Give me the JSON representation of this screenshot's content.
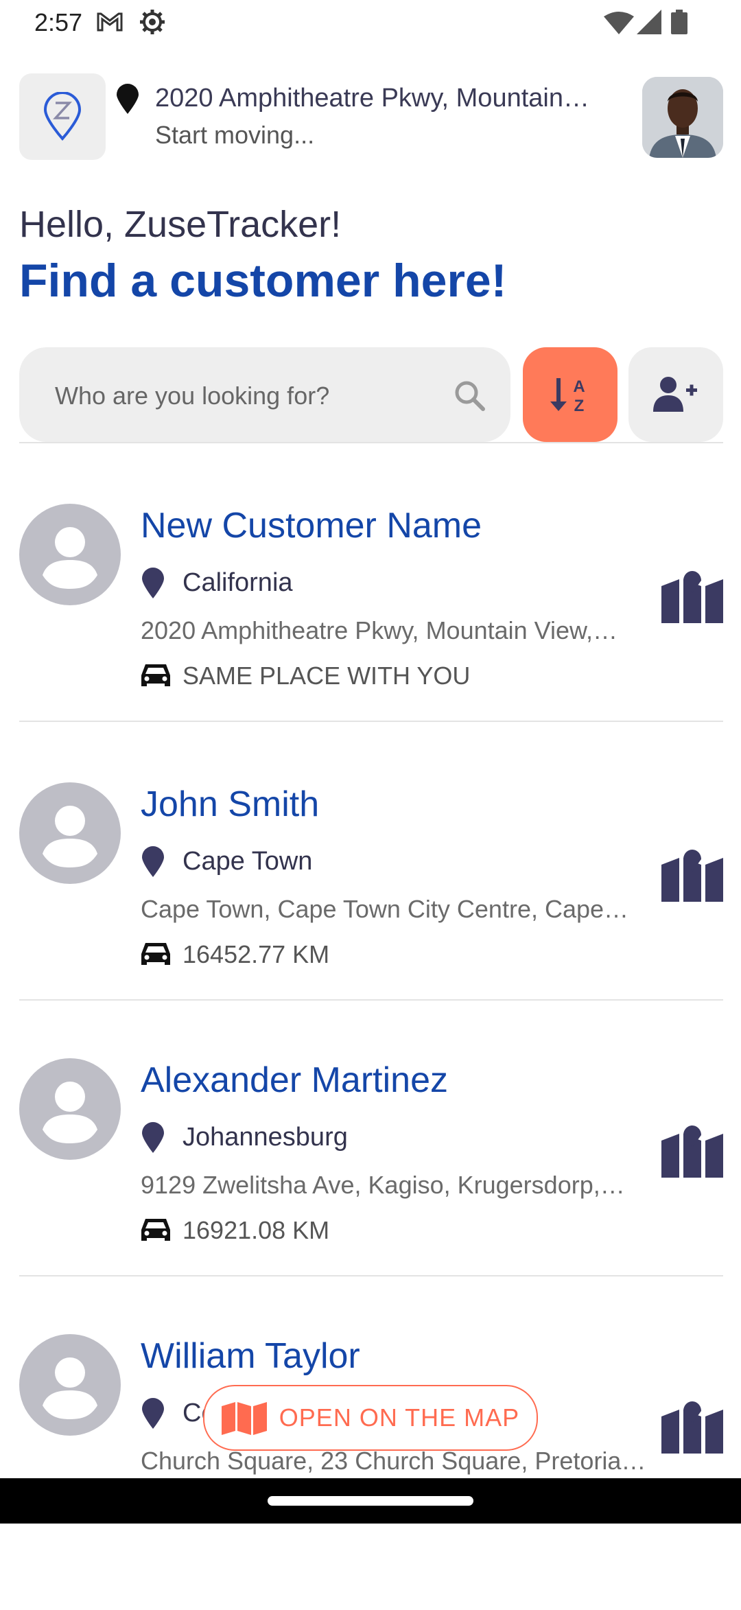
{
  "status_bar": {
    "time": "2:57",
    "icons": [
      "gmail-icon",
      "settings-gear-icon",
      "wifi-icon",
      "cell-signal-icon",
      "battery-icon"
    ]
  },
  "header": {
    "logo_icon": "zuse-pin-logo-icon",
    "location_address": "2020 Amphitheatre Pkwy, Mountain…",
    "location_status": "Start moving..."
  },
  "greeting": "Hello, ZuseTracker!",
  "headline": "Find a customer here!",
  "search": {
    "placeholder": "Who are you looking for?",
    "value": ""
  },
  "colors": {
    "accent": "#ff7a59",
    "brand_blue": "#1446a8",
    "icon_dark": "#3b3a62"
  },
  "customers": [
    {
      "name": "New Customer Name",
      "city": "California",
      "address": "2020 Amphitheatre Pkwy, Mountain View,…",
      "distance": "SAME PLACE WITH YOU"
    },
    {
      "name": "John Smith",
      "city": "Cape Town",
      "address": "Cape Town, Cape Town City Centre, Cape…",
      "distance": "16452.77 KM"
    },
    {
      "name": "Alexander Martinez",
      "city": "Johannesburg",
      "address": "9129 Zwelitsha Ave, Kagiso, Krugersdorp,…",
      "distance": "16921.08 KM"
    },
    {
      "name": "William Taylor",
      "city": "Centurion",
      "address": "Church Square, 23 Church Square, Pretoria…",
      "distance": ""
    }
  ],
  "open_map_label": "OPEN ON THE MAP"
}
